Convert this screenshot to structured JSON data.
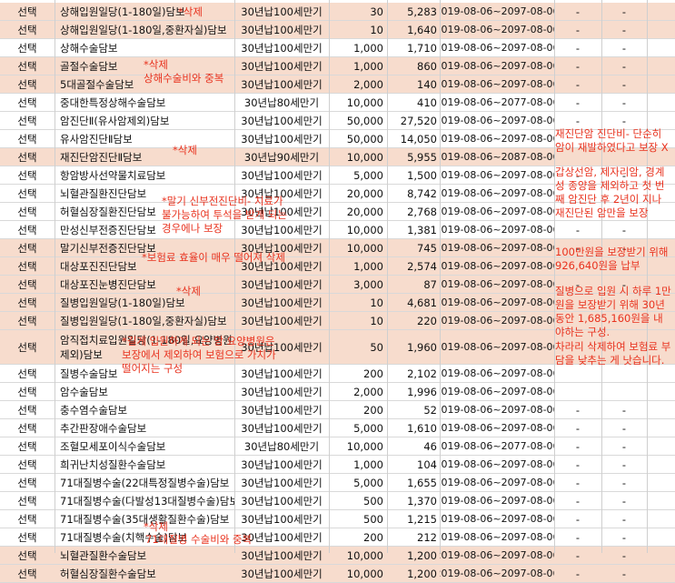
{
  "rows": [
    {
      "sel": "선택",
      "name": "상해입원일당(1-180일)담보",
      "term": "30년납100세만기",
      "amount": "30",
      "premium": "5,283",
      "period": "2019-08-06~2097-08-06",
      "e1": "-",
      "e2": "-",
      "hl": true
    },
    {
      "sel": "선택",
      "name": "상해입원일당(1-180일,중환자실)담보",
      "term": "30년납100세만기",
      "amount": "10",
      "premium": "1,640",
      "period": "2019-08-06~2097-08-06",
      "e1": "-",
      "e2": "-",
      "hl": true
    },
    {
      "sel": "선택",
      "name": "상해수술담보",
      "term": "30년납100세만기",
      "amount": "1,000",
      "premium": "1,710",
      "period": "2019-08-06~2097-08-06",
      "e1": "-",
      "e2": "-",
      "hl": false
    },
    {
      "sel": "선택",
      "name": "골절수술담보",
      "term": "30년납100세만기",
      "amount": "1,000",
      "premium": "860",
      "period": "2019-08-06~2097-08-06",
      "e1": "-",
      "e2": "-",
      "hl": true
    },
    {
      "sel": "선택",
      "name": "5대골절수술담보",
      "term": "30년납100세만기",
      "amount": "2,000",
      "premium": "140",
      "period": "2019-08-06~2097-08-06",
      "e1": "-",
      "e2": "-",
      "hl": true
    },
    {
      "sel": "선택",
      "name": "중대한특정상해수술담보",
      "term": "30년납80세만기",
      "amount": "10,000",
      "premium": "410",
      "period": "2019-08-06~2077-08-06",
      "e1": "-",
      "e2": "-",
      "hl": false
    },
    {
      "sel": "선택",
      "name": "암진단Ⅱ(유사암제외)담보",
      "term": "30년납100세만기",
      "amount": "50,000",
      "premium": "27,520",
      "period": "2019-08-06~2097-08-06",
      "e1": "-",
      "e2": "-",
      "hl": false
    },
    {
      "sel": "선택",
      "name": "유사암진단Ⅱ담보",
      "term": "30년납100세만기",
      "amount": "50,000",
      "premium": "14,050",
      "period": "2019-08-06~2097-08-06",
      "e1": "",
      "e2": "",
      "hl": false
    },
    {
      "sel": "선택",
      "name": "재진단암진단Ⅱ담보",
      "term": "30년납90세만기",
      "amount": "10,000",
      "premium": "5,955",
      "period": "2019-08-06~2087-08-06",
      "e1": "",
      "e2": "",
      "hl": true
    },
    {
      "sel": "선택",
      "name": "항암방사선약물치료담보",
      "term": "30년납100세만기",
      "amount": "5,000",
      "premium": "1,500",
      "period": "2019-08-06~2097-08-06",
      "e1": "-",
      "e2": "-",
      "hl": false
    },
    {
      "sel": "선택",
      "name": "뇌혈관질환진단담보",
      "term": "30년납100세만기",
      "amount": "20,000",
      "premium": "8,742",
      "period": "2019-08-06~2097-08-06",
      "e1": "",
      "e2": "",
      "hl": false
    },
    {
      "sel": "선택",
      "name": "허혈심장질환진단담보",
      "term": "30년납100세만기",
      "amount": "20,000",
      "premium": "2,768",
      "period": "2019-08-06~2097-08-06",
      "e1": "",
      "e2": "",
      "hl": false
    },
    {
      "sel": "선택",
      "name": "만성신부전증진단담보",
      "term": "30년납100세만기",
      "amount": "10,000",
      "premium": "1,381",
      "period": "2019-08-06~2097-08-06",
      "e1": "-",
      "e2": "-",
      "hl": false
    },
    {
      "sel": "선택",
      "name": "말기신부전증진단담보",
      "term": "30년납100세만기",
      "amount": "10,000",
      "premium": "745",
      "period": "2019-08-06~2097-08-06",
      "e1": "-",
      "e2": "-",
      "hl": true
    },
    {
      "sel": "선택",
      "name": "대상포진진단담보",
      "term": "30년납100세만기",
      "amount": "1,000",
      "premium": "2,574",
      "period": "2019-08-06~2097-08-06",
      "e1": "",
      "e2": "",
      "hl": true
    },
    {
      "sel": "선택",
      "name": "대상포진눈병진단담보",
      "term": "30년납100세만기",
      "amount": "3,000",
      "premium": "87",
      "period": "2019-08-06~2097-08-06",
      "e1": "-",
      "e2": "-",
      "hl": true
    },
    {
      "sel": "선택",
      "name": "질병입원일당(1-180일)담보",
      "term": "30년납100세만기",
      "amount": "10",
      "premium": "4,681",
      "period": "2019-08-06~2097-08-06",
      "e1": "",
      "e2": "",
      "hl": true
    },
    {
      "sel": "선택",
      "name": "질병입원일당(1-180일,중환자실)담보",
      "term": "30년납100세만기",
      "amount": "10",
      "premium": "220",
      "period": "2019-08-06~2097-08-06",
      "e1": "",
      "e2": "",
      "hl": true
    },
    {
      "sel": "선택",
      "name": "암직접치료입원일당(1-180일,요양병원제외)담보",
      "term": "30년납100세만기",
      "amount": "50",
      "premium": "1,960",
      "period": "2019-08-06~2097-08-06",
      "e1": "",
      "e2": "",
      "hl": true,
      "tall": true
    },
    {
      "sel": "선택",
      "name": "질병수술담보",
      "term": "30년납100세만기",
      "amount": "200",
      "premium": "2,102",
      "period": "2019-08-06~2097-08-06",
      "e1": "",
      "e2": "",
      "hl": false
    },
    {
      "sel": "선택",
      "name": "암수술담보",
      "term": "30년납100세만기",
      "amount": "2,000",
      "premium": "1,996",
      "period": "2019-08-06~2097-08-06",
      "e1": "",
      "e2": "",
      "hl": false
    },
    {
      "sel": "선택",
      "name": "충수염수술담보",
      "term": "30년납100세만기",
      "amount": "200",
      "premium": "52",
      "period": "2019-08-06~2097-08-06",
      "e1": "-",
      "e2": "-",
      "hl": false
    },
    {
      "sel": "선택",
      "name": "추간판장애수술담보",
      "term": "30년납100세만기",
      "amount": "5,000",
      "premium": "1,610",
      "period": "2019-08-06~2097-08-06",
      "e1": "-",
      "e2": "-",
      "hl": false
    },
    {
      "sel": "선택",
      "name": "조혈모세포이식수술담보",
      "term": "30년납80세만기",
      "amount": "10,000",
      "premium": "46",
      "period": "2019-08-06~2077-08-06",
      "e1": "-",
      "e2": "-",
      "hl": false
    },
    {
      "sel": "선택",
      "name": "희귀난치성질환수술담보",
      "term": "30년납100세만기",
      "amount": "1,000",
      "premium": "104",
      "period": "2019-08-06~2097-08-06",
      "e1": "-",
      "e2": "-",
      "hl": false
    },
    {
      "sel": "선택",
      "name": "71대질병수술(22대특정질병수술)담보",
      "term": "30년납100세만기",
      "amount": "5,000",
      "premium": "1,655",
      "period": "2019-08-06~2097-08-06",
      "e1": "-",
      "e2": "-",
      "hl": false
    },
    {
      "sel": "선택",
      "name": "71대질병수술(다발성13대질병수술)담보",
      "term": "30년납100세만기",
      "amount": "500",
      "premium": "1,370",
      "period": "2019-08-06~2097-08-06",
      "e1": "-",
      "e2": "-",
      "hl": false
    },
    {
      "sel": "선택",
      "name": "71대질병수술(35대생활질환수술)담보",
      "term": "30년납100세만기",
      "amount": "500",
      "premium": "1,215",
      "period": "2019-08-06~2097-08-06",
      "e1": "-",
      "e2": "-",
      "hl": false
    },
    {
      "sel": "선택",
      "name": "71대질병수술(치핵수술)담보",
      "term": "30년납100세만기",
      "amount": "200",
      "premium": "212",
      "period": "2019-08-06~2097-08-06",
      "e1": "-",
      "e2": "-",
      "hl": false
    },
    {
      "sel": "선택",
      "name": "뇌혈관질환수술담보",
      "term": "30년납100세만기",
      "amount": "10,000",
      "premium": "1,200",
      "period": "2019-08-06~2097-08-06",
      "e1": "-",
      "e2": "-",
      "hl": true
    },
    {
      "sel": "선택",
      "name": "허혈심장질환수술담보",
      "term": "30년납100세만기",
      "amount": "10,000",
      "premium": "1,200",
      "period": "2019-08-06~2097-08-06",
      "e1": "-",
      "e2": "-",
      "hl": true
    }
  ],
  "annotations": {
    "delete_1": "*삭제",
    "delete_2": "*삭제",
    "dup_injury": "상해수술비와 중복",
    "delete_3": "*삭제",
    "kidney_note": "*말기 신부전진단비- 치료가 불가능하여 투석을 받게 되는 경우에나 보장",
    "shingles_note": "*보험료 효율이 매우 떨어져 삭제",
    "delete_4": "*삭제",
    "hospital_note": "*길게 입원하게 되는 암 요양병원은 보장에서 제외하여 보험으로 가치가 떨어지는 구성",
    "delete_5": "*삭제",
    "dup_disease": "71대질병 수술비와 중복"
  },
  "side_notes": {
    "recurrence": "재진단암 진단비- 단순히 암이 재발하였다고 보장 X",
    "thyroid": "갑상선암, 제자리암, 경계성 종양을 제외하고 첫 번째 암진단 후 2년이 지나 재진단된 암만을 보장",
    "pay": "100만원을 보장받기 위해 926,640원을 납부",
    "daily": "질병으로 입원 시 하루 1만원을 보장받기 위해 30년 동안 1,685,160원을 내야하는 구성.",
    "reduce": "차라리 삭제하여 보험료 부담을 낮추는 게 낫습니다."
  }
}
